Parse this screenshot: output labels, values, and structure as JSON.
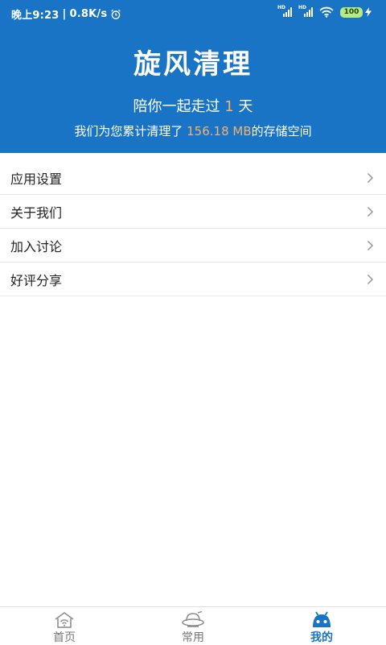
{
  "status_bar": {
    "time": "晚上9:23",
    "speed": "0.8K/s",
    "signal_label_1": "HD",
    "signal_label_2": "HD",
    "battery": "100"
  },
  "header": {
    "app_title": "旋风清理",
    "days_prefix": "陪你一起走过",
    "days_value": "1",
    "days_suffix": "天",
    "storage_prefix": "我们为您累计清理了",
    "storage_value": "156.18 MB",
    "storage_suffix": "的存储空间"
  },
  "menu": {
    "items": [
      {
        "label": "应用设置"
      },
      {
        "label": "关于我们"
      },
      {
        "label": "加入讨论"
      },
      {
        "label": "好评分享"
      }
    ]
  },
  "tabbar": {
    "tabs": [
      {
        "label": "首页",
        "icon": "home-wifi-icon"
      },
      {
        "label": "常用",
        "icon": "ufo-icon"
      },
      {
        "label": "我的",
        "icon": "android-face-icon"
      }
    ],
    "active_index": 2
  },
  "colors": {
    "header_bg": "#1a74c6",
    "highlight": "#f5b26b",
    "active_tab": "#1a74c6",
    "inactive_tab": "#777777"
  }
}
